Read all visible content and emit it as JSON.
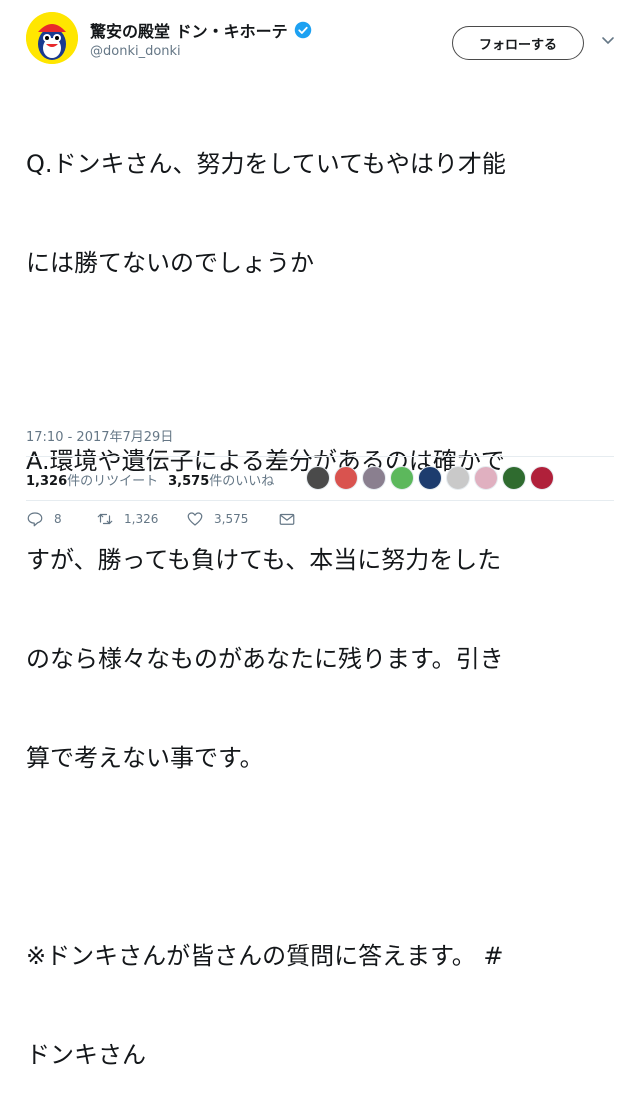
{
  "account": {
    "display_name": "驚安の殿堂 ドン・キホーテ",
    "handle": "@donki_donki",
    "follow_label": "フォローする"
  },
  "tweet": {
    "lines": [
      "Q.ドンキさん、努力をしていてもやはり才能",
      "には勝てないのでしょうか",
      "",
      "A.環境や遺伝子による差分があるのは確かで",
      "すが、勝っても負けても、本当に努力をした",
      "のなら様々なものがあなたに残ります。引き",
      "算で考えない事です。",
      "",
      "※ドンキさんが皆さんの質問に答えます。 #",
      "ドンキさん"
    ],
    "timestamp": "17:10 - 2017年7月29日"
  },
  "stats": {
    "retweets_count": "1,326",
    "retweets_label": "件のリツイート",
    "likes_count": "3,575",
    "likes_label": "件のいいね"
  },
  "likers": [
    {
      "name": "liker-avatar-1",
      "color": "#4a4a4a"
    },
    {
      "name": "liker-avatar-2",
      "color": "#d9534f"
    },
    {
      "name": "liker-avatar-3",
      "color": "#8a7f8f"
    },
    {
      "name": "liker-avatar-4",
      "color": "#5cb85c"
    },
    {
      "name": "liker-avatar-5",
      "color": "#1d3c6e"
    },
    {
      "name": "liker-avatar-6",
      "color": "#c9c9c9"
    },
    {
      "name": "liker-avatar-7",
      "color": "#e0b0c0"
    },
    {
      "name": "liker-avatar-8",
      "color": "#2f6b2f"
    },
    {
      "name": "liker-avatar-9",
      "color": "#b0203a"
    }
  ],
  "actions": {
    "reply_count": "8",
    "retweet_count": "1,326",
    "like_count": "3,575"
  },
  "colors": {
    "text": "#14171a",
    "secondary": "#657786",
    "verified": "#1da1f2",
    "divider": "#e6ecf0"
  }
}
